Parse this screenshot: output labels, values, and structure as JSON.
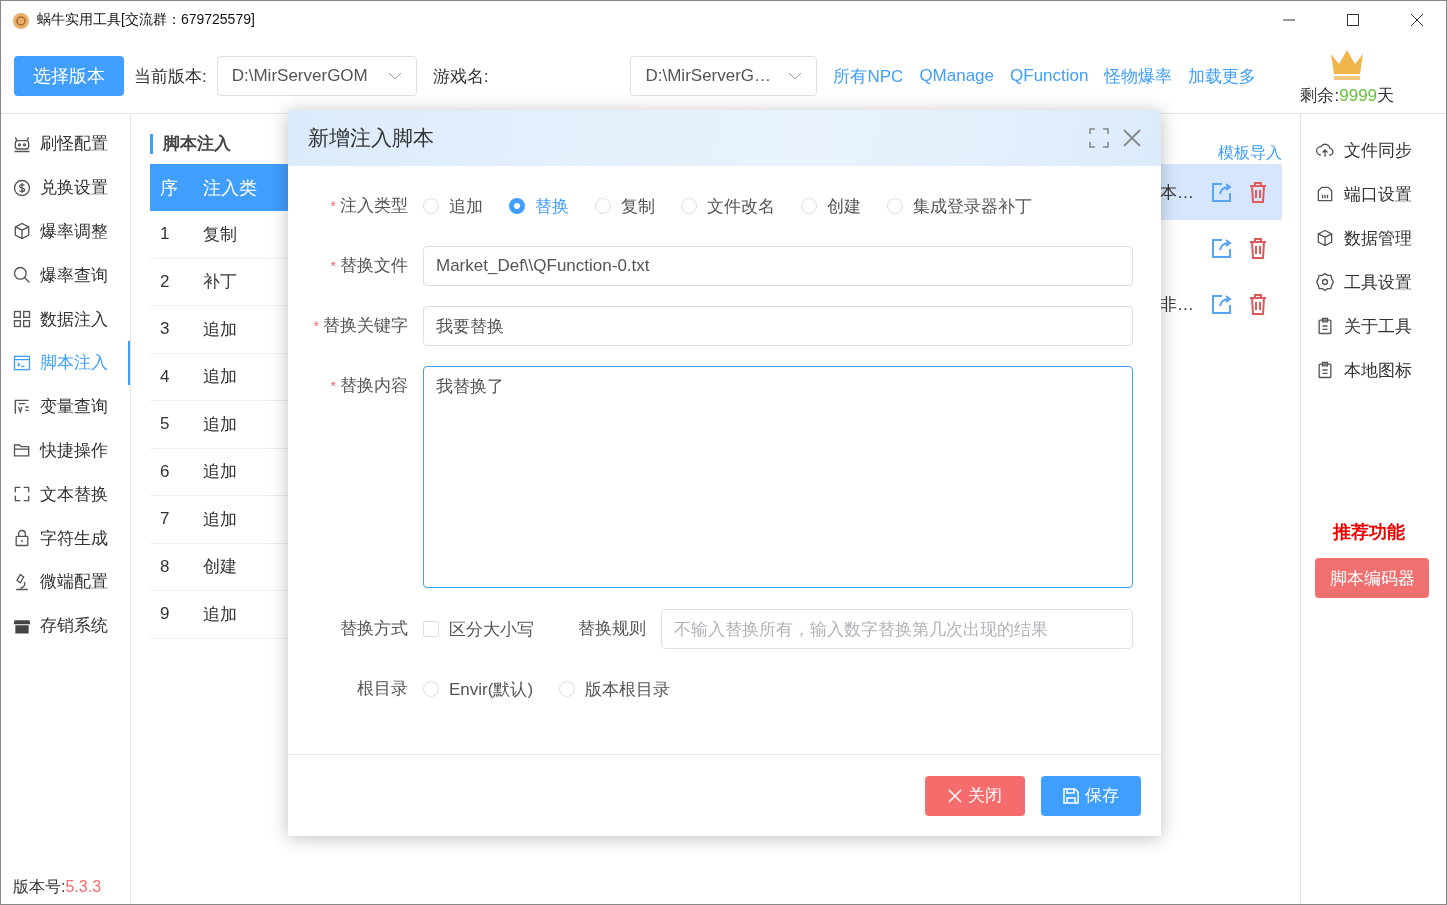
{
  "window": {
    "title": "蜗牛实用工具[交流群：679725579]"
  },
  "toolbar": {
    "select_button": "选择版本",
    "version_label": "当前版本:",
    "version_value": "D:\\MirServerGOM",
    "game_label": "游戏名:",
    "game_value": "D:\\MirServerG…",
    "links": [
      "所有NPC",
      "QManage",
      "QFunction",
      "怪物爆率",
      "加载更多"
    ],
    "remaining": {
      "label": "剩余:",
      "value": "9999",
      "unit": "天"
    }
  },
  "sidebar": {
    "items": [
      {
        "label": "刷怪配置",
        "selected": false
      },
      {
        "label": "兑换设置",
        "selected": false
      },
      {
        "label": "爆率调整",
        "selected": false
      },
      {
        "label": "爆率查询",
        "selected": false
      },
      {
        "label": "数据注入",
        "selected": false
      },
      {
        "label": "脚本注入",
        "selected": true
      },
      {
        "label": "变量查询",
        "selected": false
      },
      {
        "label": "快捷操作",
        "selected": false
      },
      {
        "label": "文本替换",
        "selected": false
      },
      {
        "label": "字符生成",
        "selected": false
      },
      {
        "label": "微端配置",
        "selected": false
      },
      {
        "label": "存销系统",
        "selected": false
      }
    ],
    "version_label": "版本号:",
    "version_value": "5.3.3"
  },
  "main": {
    "title": "脚本注入",
    "template_link": "模板导入",
    "table": {
      "columns": [
        "序",
        "注入类"
      ],
      "rows": [
        [
          "1",
          "复制"
        ],
        [
          "2",
          "补丁"
        ],
        [
          "3",
          "追加"
        ],
        [
          "4",
          "追加"
        ],
        [
          "5",
          "追加"
        ],
        [
          "6",
          "追加"
        ],
        [
          "7",
          "追加"
        ],
        [
          "8",
          "创建"
        ],
        [
          "9",
          "追加"
        ]
      ],
      "right_rows": [
        {
          "text": "本…",
          "selected": true
        },
        {
          "text": "",
          "selected": false
        },
        {
          "text": "非…",
          "selected": false
        }
      ]
    }
  },
  "right_menu": {
    "items": [
      "文件同步",
      "端口设置",
      "数据管理",
      "工具设置",
      "关于工具",
      "本地图标"
    ],
    "recommend_title": "推荐功能",
    "recommend_button": "脚本编码器"
  },
  "dialog": {
    "title": "新增注入脚本",
    "inject_type": {
      "label": "注入类型",
      "required_mark": "*",
      "options": [
        {
          "label": "追加",
          "selected": false
        },
        {
          "label": "替换",
          "selected": true
        },
        {
          "label": "复制",
          "selected": false
        },
        {
          "label": "文件改名",
          "selected": false
        },
        {
          "label": "创建",
          "selected": false
        },
        {
          "label": "集成登录器补丁",
          "selected": false
        }
      ]
    },
    "file": {
      "label": "替换文件",
      "required_mark": "*",
      "value": "Market_Def\\\\QFunction-0.txt"
    },
    "keyword": {
      "label": "替换关键字",
      "required_mark": "*",
      "value": "我要替换"
    },
    "content": {
      "label": "替换内容",
      "required_mark": "*",
      "value": "我替换了"
    },
    "mode": {
      "label": "替换方式",
      "checkbox": {
        "label": "区分大小写",
        "checked": false
      },
      "rule_label": "替换规则",
      "rule_placeholder": "不输入替换所有，输入数字替换第几次出现的结果"
    },
    "root": {
      "label": "根目录",
      "options": [
        {
          "label": "Envir(默认)",
          "selected": false
        },
        {
          "label": "版本根目录",
          "selected": false
        }
      ]
    },
    "buttons": [
      {
        "label": "关闭",
        "kind": "close"
      },
      {
        "label": "保存",
        "kind": "save"
      }
    ]
  }
}
